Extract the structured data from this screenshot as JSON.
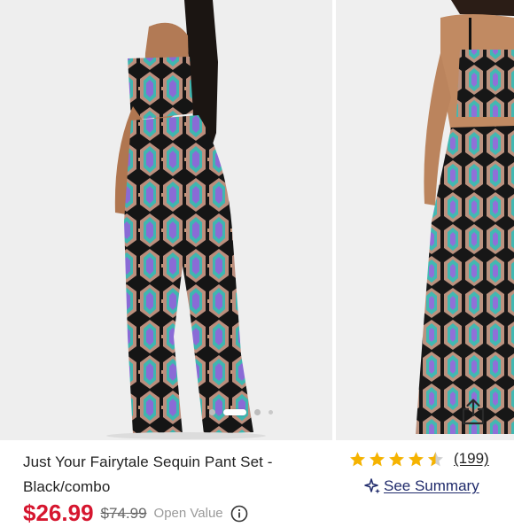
{
  "gallery": {
    "images": [
      {
        "icon": "model-back-view-image"
      },
      {
        "icon": "model-front-view-image"
      }
    ],
    "dots_count": 4,
    "active_dot": 1,
    "share_icon": "share-upload-icon"
  },
  "product": {
    "title": "Just Your Fairytale Sequin Pant Set - Black/combo",
    "rating": 4.5,
    "rating_max": 5,
    "review_count": "(199)",
    "see_summary": "See Summary",
    "summary_icon": "sparkle-icon",
    "star_color": "#f5b301",
    "price": "$26.99",
    "original_price": "$74.99",
    "price_note": "Open Value",
    "info_icon": "info-icon",
    "sale_color": "#d6162f"
  }
}
